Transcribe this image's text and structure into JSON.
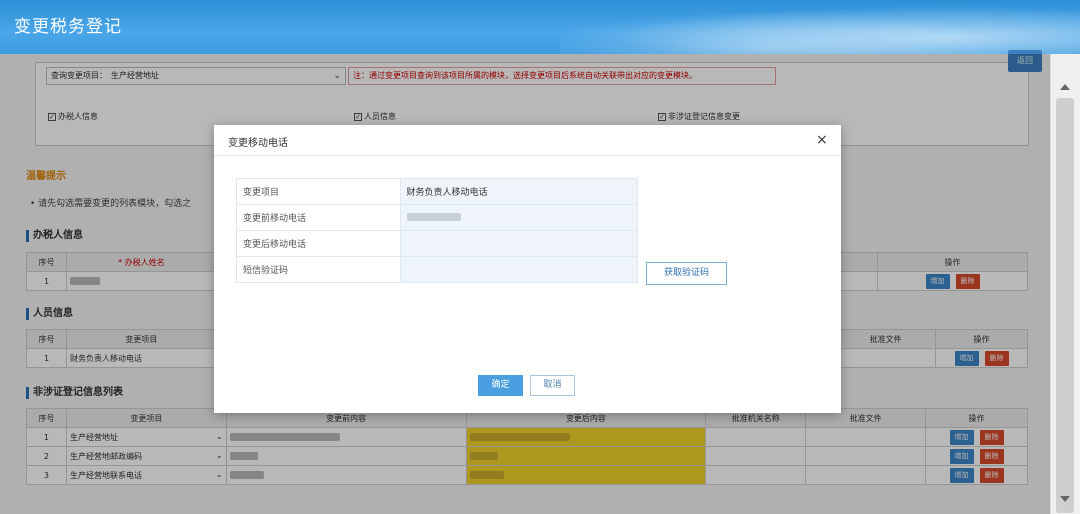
{
  "window": {
    "title": "变更税务登记"
  },
  "query": {
    "label": "查询变更项目：",
    "value": "生产经营地址",
    "note": "注：通过变更项目查询到该项目所属的模块，选择变更项目后系统自动关联带出对应的变更模块。",
    "checkboxes": [
      {
        "label": "办税人信息",
        "checked": true
      },
      {
        "label": "人员信息",
        "checked": true
      },
      {
        "label": "非涉证登记信息变更",
        "checked": true
      }
    ]
  },
  "top_button": "返回",
  "tips": {
    "title": "温馨提示",
    "text": "• 请先勾选需要变更的列表模块，勾选之"
  },
  "sections": {
    "taxer": {
      "title": "办税人信息",
      "headers": {
        "seq": "序号",
        "name": "* 办税人姓名",
        "op": "操作"
      },
      "rows": [
        {
          "seq": "1"
        }
      ]
    },
    "person": {
      "title": "人员信息",
      "headers": {
        "seq": "序号",
        "item": "变更项目",
        "doc": "批准文件",
        "op": "操作"
      },
      "rows": [
        {
          "seq": "1",
          "item": "财务负责人移动电话"
        }
      ]
    },
    "nonlicense": {
      "title": "非涉证登记信息列表",
      "headers": {
        "seq": "序号",
        "item": "变更项目",
        "before": "变更前内容",
        "after": "变更后内容",
        "org": "批准机关名称",
        "doc": "批准文件",
        "op": "操作"
      },
      "rows": [
        {
          "seq": "1",
          "item": "生产经营地址"
        },
        {
          "seq": "2",
          "item": "生产经营地邮政编码"
        },
        {
          "seq": "3",
          "item": "生产经营地联系电话"
        }
      ]
    }
  },
  "buttons": {
    "add": "增加",
    "delete": "删除"
  },
  "modal": {
    "title": "变更移动电话",
    "close_icon": "×",
    "rows": [
      {
        "label": "变更项目",
        "value": "财务负责人移动电话"
      },
      {
        "label": "变更前移动电话",
        "value": ""
      },
      {
        "label": "变更后移动电话",
        "value": ""
      },
      {
        "label": "短信验证码",
        "value": ""
      }
    ],
    "get_code": "获取验证码",
    "ok": "确定",
    "cancel": "取消"
  },
  "colors": {
    "header": "#2d8fd6",
    "add_button": "#3e86c8",
    "delete_button": "#d94a2c",
    "highlight": "#f2d12a",
    "warning": "#e08a10"
  }
}
